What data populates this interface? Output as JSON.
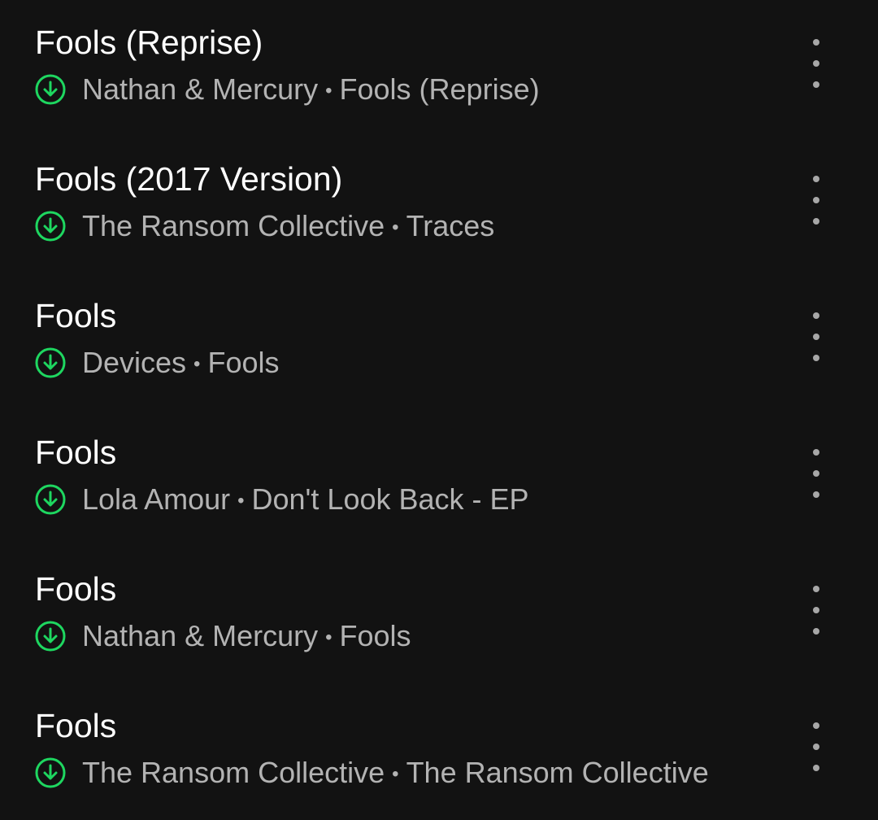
{
  "colors": {
    "background": "#121212",
    "title": "#ffffff",
    "subtitle": "#b3b3b3",
    "downloaded": "#1ed760",
    "more_dots": "#a7a7a7"
  },
  "icons": {
    "downloaded": "downloaded-icon",
    "more": "more-options-icon"
  },
  "separator": "•",
  "tracks": [
    {
      "title": "Fools (Reprise)",
      "artist": "Nathan & Mercury",
      "album": "Fools (Reprise)"
    },
    {
      "title": "Fools (2017 Version)",
      "artist": "The Ransom Collective",
      "album": "Traces"
    },
    {
      "title": "Fools",
      "artist": "Devices",
      "album": "Fools"
    },
    {
      "title": "Fools",
      "artist": "Lola Amour",
      "album": "Don't Look Back - EP"
    },
    {
      "title": "Fools",
      "artist": "Nathan & Mercury",
      "album": "Fools"
    },
    {
      "title": "Fools",
      "artist": "The Ransom Collective",
      "album": "The Ransom Collective"
    }
  ]
}
